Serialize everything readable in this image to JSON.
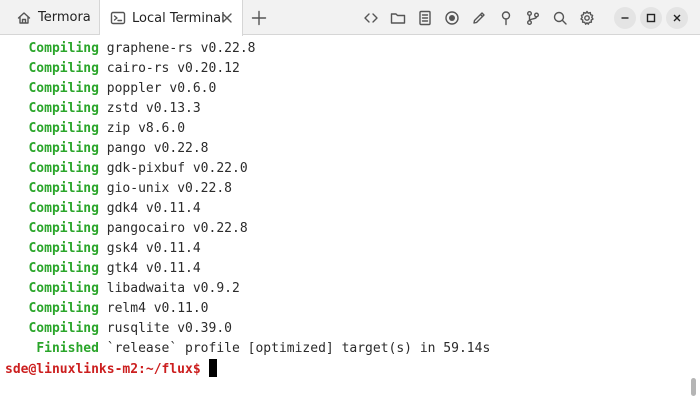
{
  "tabs": [
    {
      "label": "Termora",
      "icon": "home-icon"
    },
    {
      "label": "Local Terminal",
      "icon": "terminal-icon",
      "active": true
    }
  ],
  "toolbar_icons": [
    "code-icon",
    "folder-icon",
    "document-icon",
    "record-icon",
    "edit-icon",
    "pin-icon",
    "branch-icon",
    "search-icon",
    "gear-icon"
  ],
  "window_controls": [
    "minimize-icon",
    "maximize-icon",
    "close-icon"
  ],
  "terminal": {
    "lines": [
      {
        "indent": "   ",
        "keyword": "Compiling",
        "text": " graphene-rs v0.22.8"
      },
      {
        "indent": "   ",
        "keyword": "Compiling",
        "text": " cairo-rs v0.20.12"
      },
      {
        "indent": "   ",
        "keyword": "Compiling",
        "text": " poppler v0.6.0"
      },
      {
        "indent": "   ",
        "keyword": "Compiling",
        "text": " zstd v0.13.3"
      },
      {
        "indent": "   ",
        "keyword": "Compiling",
        "text": " zip v8.6.0"
      },
      {
        "indent": "   ",
        "keyword": "Compiling",
        "text": " pango v0.22.8"
      },
      {
        "indent": "   ",
        "keyword": "Compiling",
        "text": " gdk-pixbuf v0.22.0"
      },
      {
        "indent": "   ",
        "keyword": "Compiling",
        "text": " gio-unix v0.22.8"
      },
      {
        "indent": "   ",
        "keyword": "Compiling",
        "text": " gdk4 v0.11.4"
      },
      {
        "indent": "   ",
        "keyword": "Compiling",
        "text": " pangocairo v0.22.8"
      },
      {
        "indent": "   ",
        "keyword": "Compiling",
        "text": " gsk4 v0.11.4"
      },
      {
        "indent": "   ",
        "keyword": "Compiling",
        "text": " gtk4 v0.11.4"
      },
      {
        "indent": "   ",
        "keyword": "Compiling",
        "text": " libadwaita v0.9.2"
      },
      {
        "indent": "   ",
        "keyword": "Compiling",
        "text": " relm4 v0.11.0"
      },
      {
        "indent": "   ",
        "keyword": "Compiling",
        "text": " rusqlite v0.39.0"
      },
      {
        "indent": "    ",
        "keyword": "Finished",
        "text": " `release` profile [optimized] target(s) in 59.14s"
      }
    ],
    "prompt": "sde@linuxlinks-m2:~/flux$"
  },
  "colors": {
    "keyword_green": "#2aa52a",
    "prompt_red": "#cc1f1f",
    "text": "#2b2b2b",
    "tabbar_bg": "#f2f2f2"
  }
}
